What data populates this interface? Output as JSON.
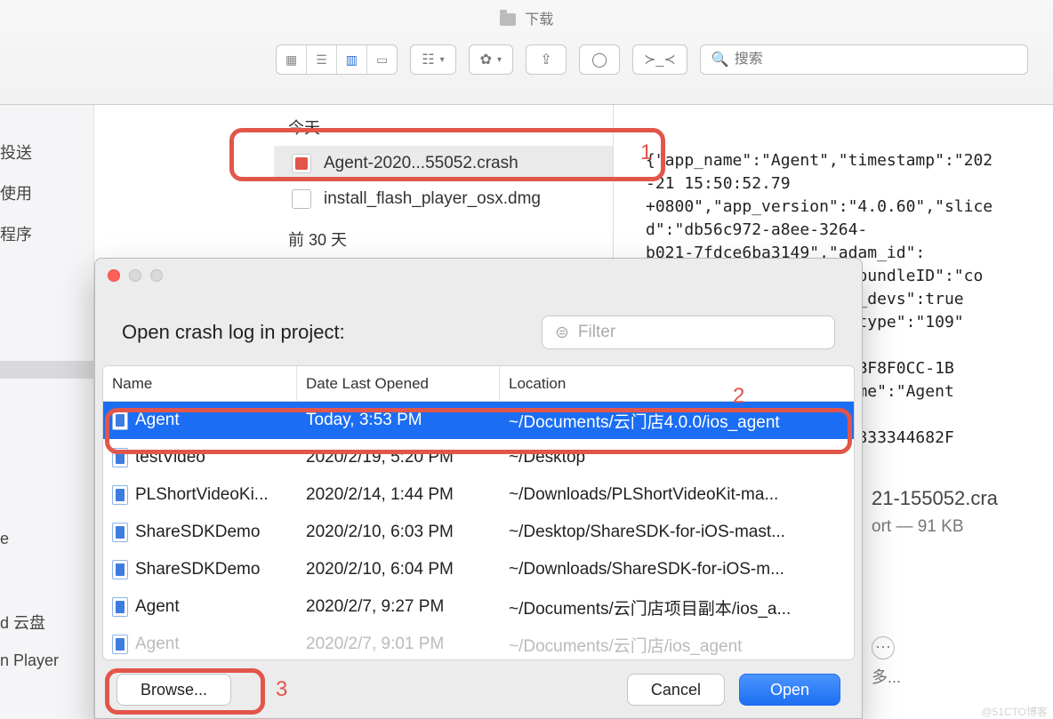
{
  "finder": {
    "title": "下载",
    "search_placeholder": "搜索",
    "sections": {
      "today": "今天",
      "last30": "前 30 天"
    },
    "files": [
      {
        "name": "Agent-2020...55052.crash",
        "selected": true
      },
      {
        "name": "install_flash_player_osx.dmg",
        "selected": false
      }
    ],
    "preview_text": "{\"app_name\":\"Agent\",\"timestamp\":\"202\n-21 15:50:52.79\n+0800\",\"app_version\":\"4.0.60\",\"slice\nd\":\"db56c972-a8ee-3264-\nb021-7fdce6ba3149\",\"adam_id\":\n                    ,\"bundleID\":\"co\n                 h_app_devs\":true\n                 \"bug_type\":\"109\"\n                  12.0\n                id\":\"3BF8F0CC-1B\n                F\",\"name\":\"Agent\n\n                018-5E833344682F",
    "meta_name": "21-155052.cra",
    "meta_sub": "ort — 91 KB",
    "more_label": "多..."
  },
  "sidebar": {
    "items": [
      "投送",
      "使用",
      "程序",
      "",
      "",
      "",
      "",
      "e",
      "d 云盘",
      "n Player"
    ],
    "selected_index": 3
  },
  "dialog": {
    "title": "Open crash log in project:",
    "filter_placeholder": "Filter",
    "columns": {
      "name": "Name",
      "date": "Date Last Opened",
      "location": "Location"
    },
    "rows": [
      {
        "name": "Agent",
        "date": "Today, 3:53 PM",
        "location": "~/Documents/云门店4.0.0/ios_agent",
        "selected": true
      },
      {
        "name": "testVideo",
        "date": "2020/2/19, 5:20 PM",
        "location": "~/Desktop"
      },
      {
        "name": "PLShortVideoKi...",
        "date": "2020/2/14, 1:44 PM",
        "location": "~/Downloads/PLShortVideoKit-ma..."
      },
      {
        "name": "ShareSDKDemo",
        "date": "2020/2/10, 6:03 PM",
        "location": "~/Desktop/ShareSDK-for-iOS-mast..."
      },
      {
        "name": "ShareSDKDemo",
        "date": "2020/2/10, 6:04 PM",
        "location": "~/Downloads/ShareSDK-for-iOS-m..."
      },
      {
        "name": "Agent",
        "date": "2020/2/7, 9:27 PM",
        "location": "~/Documents/云门店项目副本/ios_a..."
      },
      {
        "name": "Agent",
        "date": "2020/2/7, 9:01 PM",
        "location": "~/Documents/云门店/ios_agent",
        "dim": true
      }
    ],
    "buttons": {
      "browse": "Browse...",
      "cancel": "Cancel",
      "open": "Open"
    }
  },
  "annotations": {
    "n1": "1",
    "n2": "2",
    "n3": "3"
  },
  "watermark": "@51CTO博客"
}
